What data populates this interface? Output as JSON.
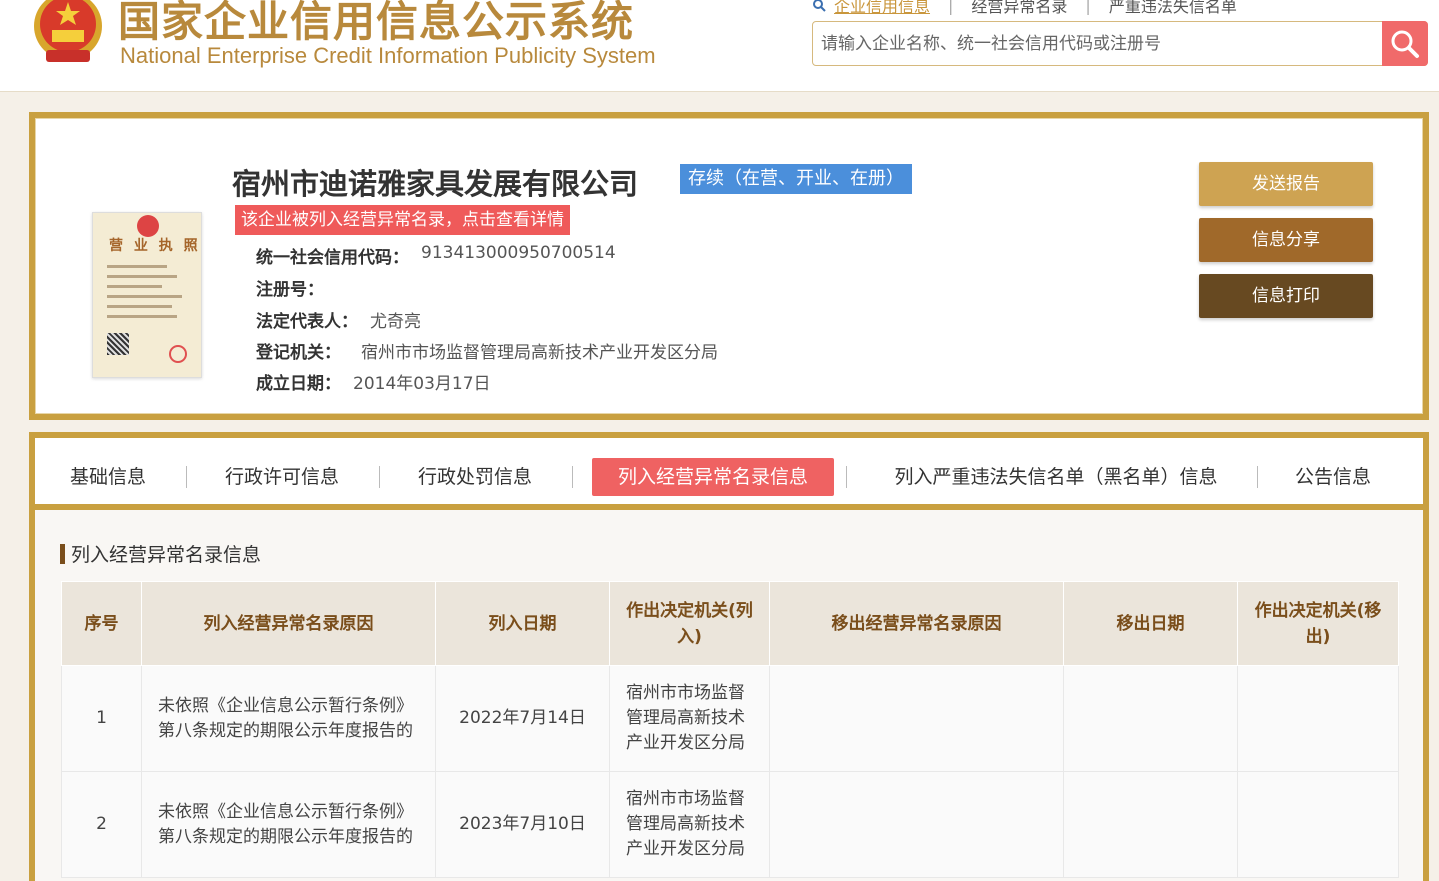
{
  "header": {
    "logo_cn": "国家企业信用信息公示系统",
    "logo_en": "National Enterprise Credit Information Publicity System",
    "search_links": [
      "企业信用信息",
      "经营异常名录",
      "严重违法失信名单"
    ],
    "search_placeholder": "请输入企业名称、统一社会信用代码或注册号"
  },
  "company": {
    "name": "宿州市迪诺雅家具发展有限公司",
    "status": "存续（在营、开业、在册）",
    "alert": "该企业被列入经营异常名录，点击查看详情",
    "license_title": "营 业 执 照",
    "fields": [
      {
        "label": "统一社会信用代码：",
        "value": "913413000950700514"
      },
      {
        "label": "注册号：",
        "value": ""
      },
      {
        "label": "法定代表人：",
        "value": "尤奇亮"
      },
      {
        "label": "登记机关：",
        "value": "宿州市市场监督管理局高新技术产业开发区分局"
      },
      {
        "label": "成立日期：",
        "value": "2014年03月17日"
      }
    ],
    "buttons": {
      "send": "发送报告",
      "share": "信息分享",
      "print": "信息打印"
    }
  },
  "tabs": [
    {
      "label": "基础信息",
      "active": false
    },
    {
      "label": "行政许可信息",
      "active": false
    },
    {
      "label": "行政处罚信息",
      "active": false
    },
    {
      "label": "列入经营异常名录信息",
      "active": true
    },
    {
      "label": "列入严重违法失信名单（黑名单）信息",
      "active": false
    },
    {
      "label": "公告信息",
      "active": false
    }
  ],
  "section": {
    "title": "列入经营异常名录信息",
    "columns": [
      "序号",
      "列入经营异常名录原因",
      "列入日期",
      "作出决定机关(列入)",
      "移出经营异常名录原因",
      "移出日期",
      "作出决定机关(移出)"
    ],
    "rows": [
      [
        "1",
        "未依照《企业信息公示暂行条例》第八条规定的期限公示年度报告的",
        "2022年7月14日",
        "宿州市市场监督管理局高新技术产业开发区分局",
        "",
        "",
        ""
      ],
      [
        "2",
        "未依照《企业信息公示暂行条例》第八条规定的期限公示年度报告的",
        "2023年7月10日",
        "宿州市市场监督管理局高新技术产业开发区分局",
        "",
        "",
        ""
      ]
    ]
  },
  "colors": {
    "gold": "#c9a040",
    "red": "#ef6262",
    "blue": "#4b8fdb",
    "brown": "#7a4e1b"
  }
}
